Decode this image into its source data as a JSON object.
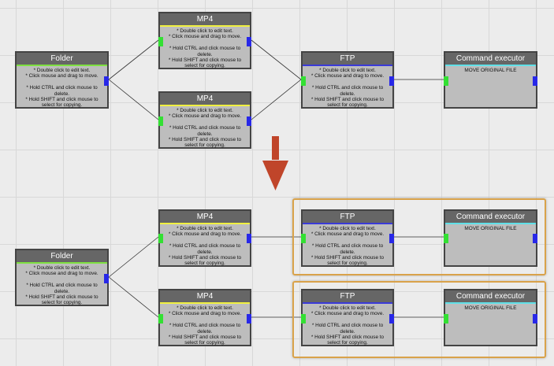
{
  "colors": {
    "canvas": "#ececec",
    "grid": "#d8d8d8",
    "node_body": "#bdbdbd",
    "node_header": "#666666",
    "input_port": "#33e033",
    "output_port": "#2828e8",
    "arrow": "#c0452a",
    "group_frame": "#d9a24a",
    "folder_accent": "#7fe040",
    "mp4_accent": "#f0f040",
    "ftp_accent": "#3a3ad8",
    "cmd_accent": "#60e0e8"
  },
  "nodes": {
    "top": {
      "folder": {
        "title": "Folder",
        "text": "* Double click to edit text.\n* Click mouse and drag to move.\n\n* Hold CTRL and click mouse to delete.\n* Hold SHIFT and click mouse to select for copying."
      },
      "mp4_a": {
        "title": "MP4",
        "text": "* Double click to edit text.\n* Click mouse and drag to move.\n\n* Hold CTRL and click mouse to delete.\n* Hold SHIFT and click mouse to select for copying."
      },
      "mp4_b": {
        "title": "MP4",
        "text": "* Double click to edit text.\n* Click mouse and drag to move.\n\n* Hold CTRL and click mouse to delete.\n* Hold SHIFT and click mouse to select for copying."
      },
      "ftp": {
        "title": "FTP",
        "text": "* Double click to edit text.\n* Click mouse and drag to move.\n\n* Hold CTRL and click mouse to delete.\n* Hold SHIFT and click mouse to select for copying."
      },
      "cmd": {
        "title": "Command executor",
        "text": "MOVE ORIGINAL FILE"
      }
    },
    "bottom": {
      "folder": {
        "title": "Folder",
        "text": "* Double click to edit text.\n* Click mouse and drag to move.\n\n* Hold CTRL and click mouse to delete.\n* Hold SHIFT and click mouse to select for copying."
      },
      "mp4_a": {
        "title": "MP4",
        "text": "* Double click to edit text.\n* Click mouse and drag to move.\n\n* Hold CTRL and click mouse to delete.\n* Hold SHIFT and click mouse to select for copying."
      },
      "mp4_b": {
        "title": "MP4",
        "text": "* Double click to edit text.\n* Click mouse and drag to move.\n\n* Hold CTRL and click mouse to delete.\n* Hold SHIFT and click mouse to select for copying."
      },
      "ftp_a": {
        "title": "FTP",
        "text": "* Double click to edit text.\n* Click mouse and drag to move.\n\n* Hold CTRL and click mouse to delete.\n* Hold SHIFT and click mouse to select for copying."
      },
      "ftp_b": {
        "title": "FTP",
        "text": "* Double click to edit text.\n* Click mouse and drag to move.\n\n* Hold CTRL and click mouse to delete.\n* Hold SHIFT and click mouse to select for copying."
      },
      "cmd_a": {
        "title": "Command executor",
        "text": "MOVE ORIGINAL FILE"
      },
      "cmd_b": {
        "title": "Command executor",
        "text": "MOVE ORIGINAL FILE"
      }
    }
  }
}
